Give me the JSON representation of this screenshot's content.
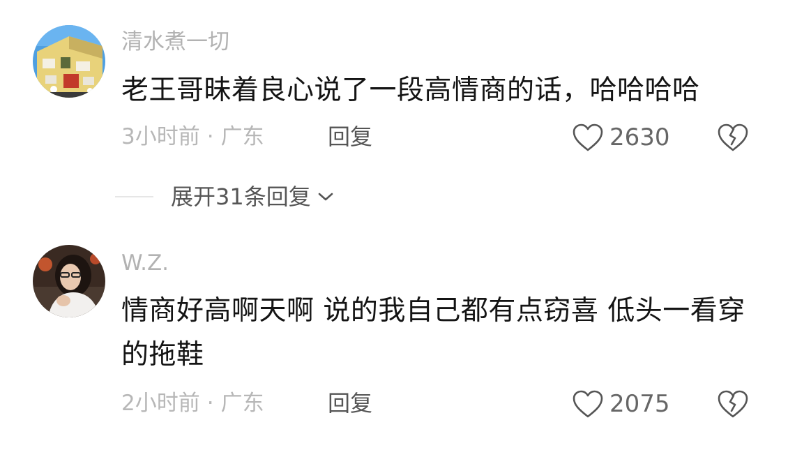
{
  "comments": [
    {
      "username": "清水煮一切",
      "text": "老王哥昧着良心说了一段高情商的话，哈哈哈哈",
      "time": "3小时前",
      "location": "广东",
      "reply_label": "回复",
      "likes": "2630",
      "avatar_icon": "painted-house-avatar"
    },
    {
      "username": "W.Z.",
      "text": "情商好高啊天啊 说的我自己都有点窃喜 低头一看穿的拖鞋",
      "time": "2小时前",
      "location": "广东",
      "reply_label": "回复",
      "likes": "2075",
      "avatar_icon": "person-photo-avatar"
    }
  ],
  "expand_replies": {
    "label": "展开31条回复",
    "icon": "chevron-down-icon"
  },
  "meta_separator": "·",
  "colors": {
    "username": "#b2b2b2",
    "text": "#141414",
    "meta": "#b7b7b7",
    "action": "#555555"
  }
}
